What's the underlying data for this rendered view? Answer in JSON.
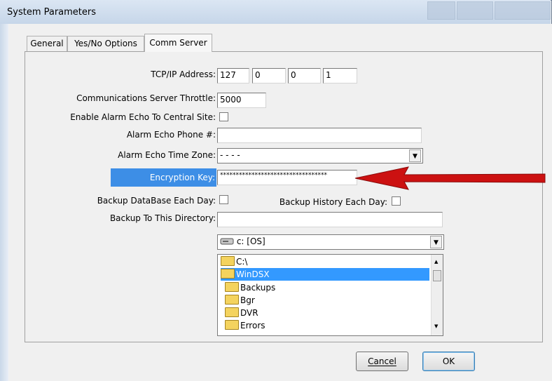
{
  "window": {
    "title": "System Parameters"
  },
  "tabs": [
    {
      "label": "General"
    },
    {
      "label": "Yes/No Options"
    },
    {
      "label": "Comm Server"
    }
  ],
  "form": {
    "tcpip_label": "TCP/IP Address:",
    "ip1": "127",
    "ip2": "0",
    "ip3": "0",
    "ip4": "1",
    "throttle_label": "Communications Server Throttle:",
    "throttle_value": "5000",
    "alarm_echo_label": "Enable Alarm Echo To Central Site:",
    "alarm_phone_label": "Alarm Echo Phone #:",
    "alarm_phone_value": "",
    "alarm_tz_label": "Alarm Echo Time Zone:",
    "alarm_tz_value": "- - - -",
    "encryption_label": "Encryption Key:",
    "encryption_value": "**********************************",
    "backup_db_label": "Backup DataBase Each Day:",
    "backup_history_label": "Backup History Each Day:",
    "backup_dir_label": "Backup To This Directory:",
    "backup_dir_value": "",
    "drive_value": "c: [OS]",
    "folders": [
      {
        "name": "C:\\"
      },
      {
        "name": "WinDSX"
      },
      {
        "name": "Backups"
      },
      {
        "name": "Bgr"
      },
      {
        "name": "DVR"
      },
      {
        "name": "Errors"
      }
    ]
  },
  "buttons": {
    "cancel_label": "Cancel",
    "ok_label": "OK"
  },
  "annotation": {
    "arrow_color": "#cc1111"
  },
  "colors": {
    "highlight": "#3399ff",
    "label_highlight": "#3d8ee6"
  }
}
